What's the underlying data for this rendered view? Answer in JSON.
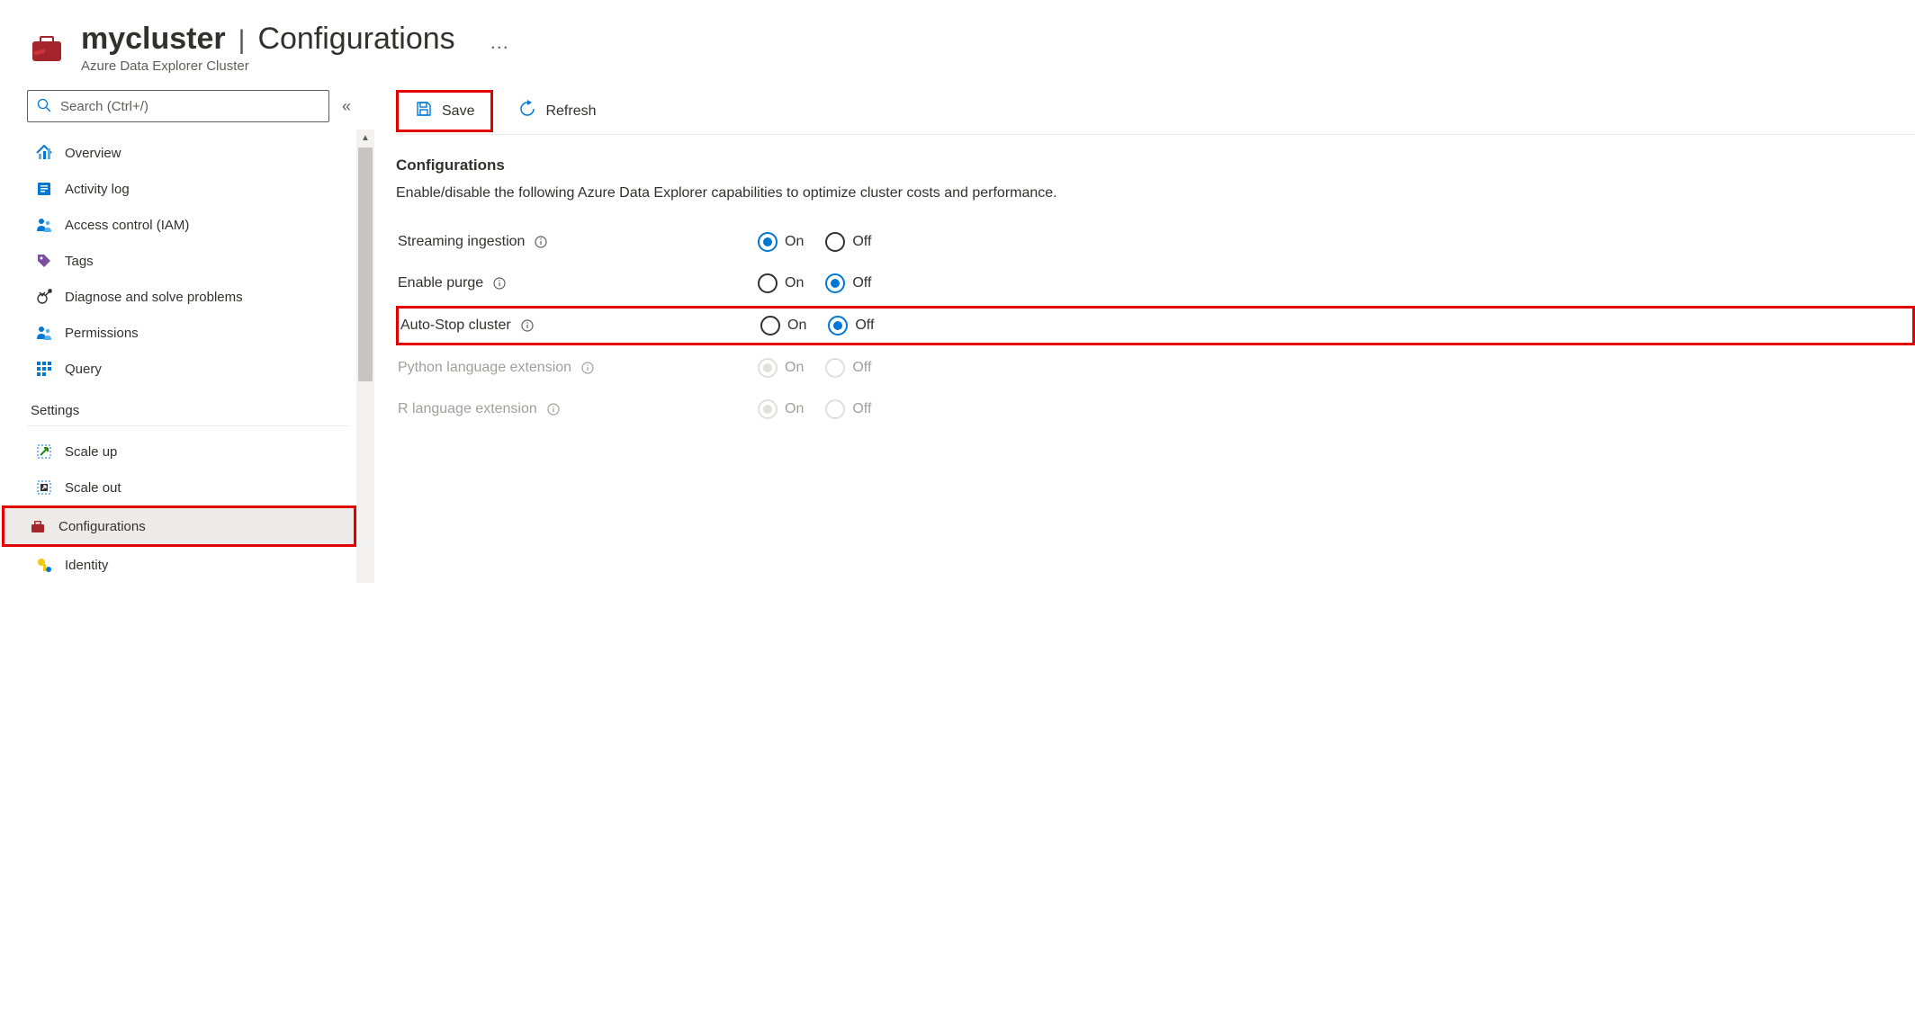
{
  "header": {
    "title": "mycluster",
    "page": "Configurations",
    "resource_type": "Azure Data Explorer Cluster",
    "ellipsis": "…"
  },
  "sidebar": {
    "search_placeholder": "Search (Ctrl+/)",
    "collapse_glyph": "«",
    "items_main": [
      {
        "label": "Overview",
        "icon": "overview"
      },
      {
        "label": "Activity log",
        "icon": "activity-log"
      },
      {
        "label": "Access control (IAM)",
        "icon": "access-control"
      },
      {
        "label": "Tags",
        "icon": "tags"
      },
      {
        "label": "Diagnose and solve problems",
        "icon": "diagnose"
      },
      {
        "label": "Permissions",
        "icon": "permissions"
      },
      {
        "label": "Query",
        "icon": "query"
      }
    ],
    "section_settings": "Settings",
    "items_settings": [
      {
        "label": "Scale up",
        "icon": "scale-up"
      },
      {
        "label": "Scale out",
        "icon": "scale-out"
      },
      {
        "label": "Configurations",
        "icon": "configurations",
        "active": true
      },
      {
        "label": "Identity",
        "icon": "identity"
      }
    ]
  },
  "toolbar": {
    "save_label": "Save",
    "refresh_label": "Refresh"
  },
  "content": {
    "title": "Configurations",
    "description": "Enable/disable the following Azure Data Explorer capabilities to optimize cluster costs and performance.",
    "on_label": "On",
    "off_label": "Off",
    "rows": [
      {
        "label": "Streaming ingestion",
        "value": "on",
        "disabled": false
      },
      {
        "label": "Enable purge",
        "value": "off",
        "disabled": false
      },
      {
        "label": "Auto-Stop cluster",
        "value": "off",
        "disabled": false,
        "highlighted": true
      },
      {
        "label": "Python language extension",
        "value": "on",
        "disabled": true
      },
      {
        "label": "R language extension",
        "value": "on",
        "disabled": true
      }
    ]
  }
}
